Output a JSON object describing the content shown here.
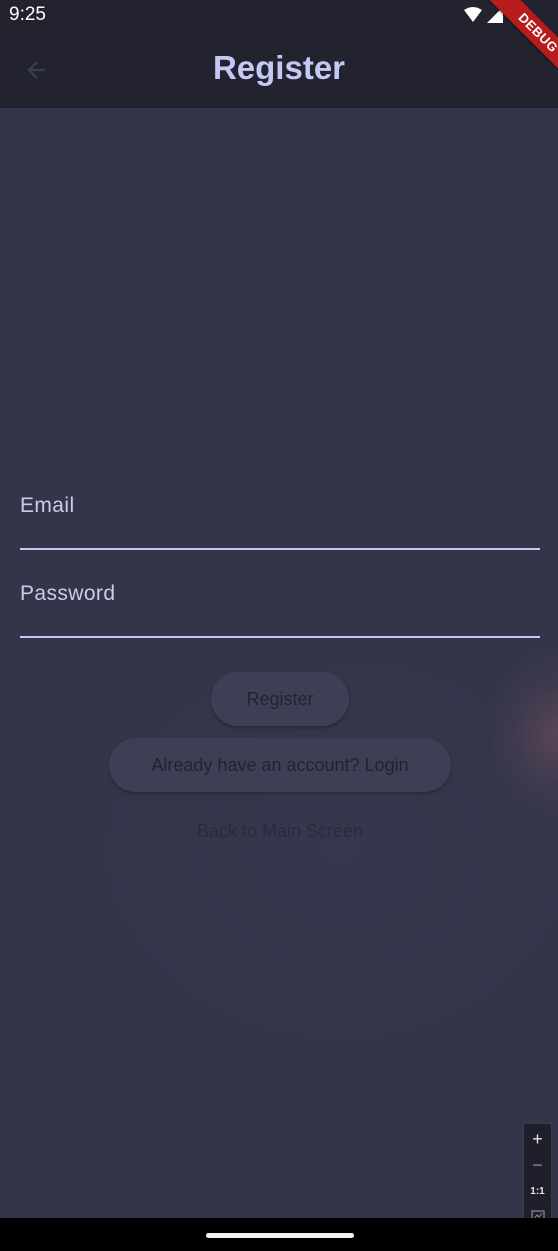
{
  "status_bar": {
    "time": "9:25",
    "icons": [
      "wifi-icon",
      "signal-icon"
    ]
  },
  "app_bar": {
    "title": "Register",
    "back_icon": "back-arrow-icon"
  },
  "debug_banner": {
    "label": "DEBUG"
  },
  "form": {
    "email_label": "Email",
    "email_value": "",
    "password_label": "Password",
    "password_value": ""
  },
  "actions": {
    "register_label": "Register",
    "login_label": "Already have an account? Login",
    "back_main_label": "Back to Main Screen"
  },
  "zoom_controls": {
    "zoom_in": "+",
    "zoom_out": "−",
    "actual_size": "1:1",
    "fit_icon": "fit-screen-icon"
  },
  "colors": {
    "background": "#343549",
    "app_bar": "#23232f",
    "title": "#c3c8f5",
    "field_underline": "#c3c8f5",
    "button_fill": "#3e3f54",
    "debug_ribbon": "#b71c1c"
  }
}
